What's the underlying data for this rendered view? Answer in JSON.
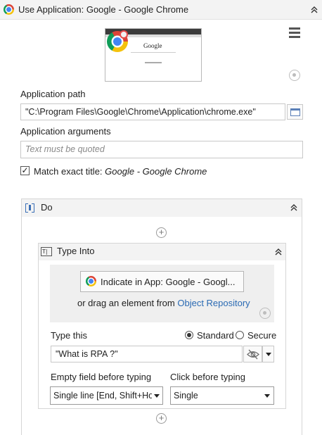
{
  "activity": {
    "title": "Use Application: Google - Google Chrome",
    "collapse_glyph": "⌃"
  },
  "preview": {
    "page_logo_text": "Google"
  },
  "app_path": {
    "label": "Application path",
    "value": "\"C:\\Program Files\\Google\\Chrome\\Application\\chrome.exe\""
  },
  "app_args": {
    "label": "Application arguments",
    "placeholder": "Text must be quoted"
  },
  "match_title": {
    "checked_glyph": "✓",
    "label": "Match exact title:",
    "value": "Google - Google Chrome"
  },
  "do_sequence": {
    "title": "Do",
    "add_glyph": "+"
  },
  "type_into": {
    "title": "Type Into",
    "icon_text": "T|",
    "indicate_button": "Indicate in App: Google - Googl...",
    "drag_text": "or drag an element from",
    "repository_link": "Object Repository",
    "type_this_label": "Type this",
    "mode_standard": "Standard",
    "mode_secure": "Secure",
    "mode_selected": "Standard",
    "text_value": "\"What is RPA ?\"",
    "empty_field_label": "Empty field before typing",
    "empty_field_value": "Single line [End, Shift+Home, Del]",
    "click_before_label": "Click before typing",
    "click_before_value": "Single"
  },
  "icons": [
    "chrome-icon",
    "collapse-icon",
    "hamburger-icon",
    "target-icon",
    "browse-icon",
    "sequence-icon",
    "type-into-icon",
    "eye-slash-icon",
    "dropdown-icon",
    "add-icon"
  ],
  "colors": {
    "header_bg": "#f3f3f3",
    "link": "#2a6ab3",
    "indicate_area_bg": "#efefef"
  }
}
